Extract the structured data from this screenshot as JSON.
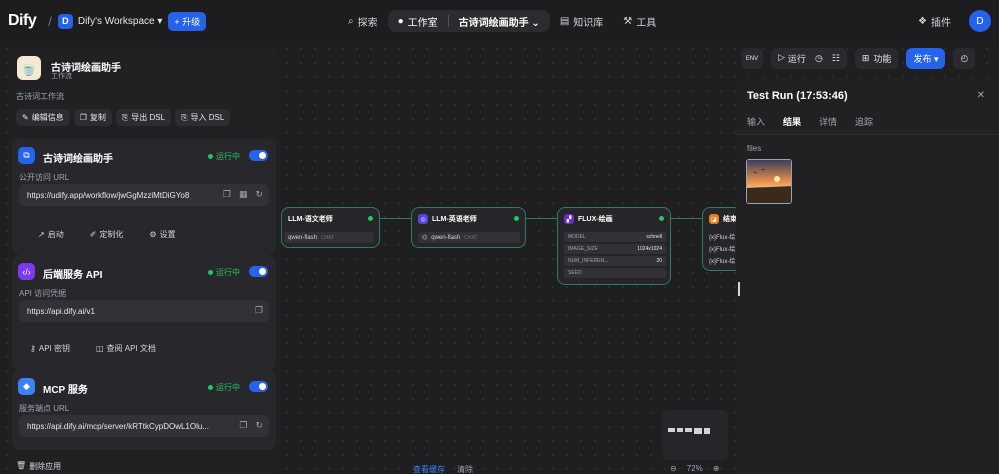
{
  "header": {
    "logo": "Dify",
    "workspace_initial": "D",
    "workspace_name": "Dify's Workspace ▾",
    "upgrade": "+ 升级",
    "nav": {
      "explore": "探索",
      "studio": "工作室",
      "current_app": "古诗词绘画助手 ⌄",
      "knowledge": "知识库",
      "tools": "工具"
    },
    "plugins": "插件",
    "user_initial": "D"
  },
  "left_panel": {
    "app_name": "古诗词绘画助手",
    "app_type": "工作流",
    "app_desc": "古诗词工作流",
    "actions": [
      "编辑信息",
      "复制",
      "导出 DSL",
      "导入 DSL"
    ],
    "webapp": {
      "title": "古诗词绘画助手",
      "status": "运行中",
      "url_label": "公开访问 URL",
      "url": "https://udify.app/workflow/jwGgMzziMtDiGYo8",
      "links": [
        "启动",
        "定制化",
        "设置"
      ]
    },
    "backend": {
      "title": "后端服务 API",
      "status": "运行中",
      "label": "API 访问凭据",
      "url": "https://api.dify.ai/v1",
      "links": [
        "API 密钥",
        "查阅 API 文档"
      ]
    },
    "mcp": {
      "title": "MCP 服务",
      "status": "运行中",
      "label": "服务端点 URL",
      "url": "https://api.dify.ai/mcp/server/kRTtkCypDOwL1Olu..."
    },
    "delete": "删除应用"
  },
  "nodes": {
    "llm1": {
      "title": "LLM-语文老师",
      "model": "qwen-flash",
      "mode": "CHAT"
    },
    "llm2": {
      "title": "LLM-英语老师",
      "model": "qwen-flash",
      "mode": "CHAT"
    },
    "flux": {
      "title": "FLUX-绘画",
      "params": [
        {
          "k": "MODEL",
          "v": "schnell"
        },
        {
          "k": "IMAGE_SIZE",
          "v": "1024x1024"
        },
        {
          "k": "NUM_INFEREN...",
          "v": "20"
        },
        {
          "k": "SEED",
          "v": ""
        }
      ]
    },
    "end": {
      "title": "结束",
      "vars": [
        "{x}Flux-绘",
        "{x}Flux-绘",
        "{x}Flux-绘"
      ]
    }
  },
  "toolbar": {
    "env": "ENV",
    "run": "运行",
    "features": "功能",
    "publish": "发布 ▾"
  },
  "test_run": {
    "title": "Test Run (17:53:46)",
    "tabs": [
      "输入",
      "结果",
      "详情",
      "追踪"
    ],
    "files_label": "files"
  },
  "bottom": {
    "view_cache": "查看缓存",
    "clear": "清除",
    "zoom": "72%"
  },
  "colors": {
    "accent": "#2563eb",
    "running": "#22c55e",
    "edge": "#2f7a63"
  }
}
